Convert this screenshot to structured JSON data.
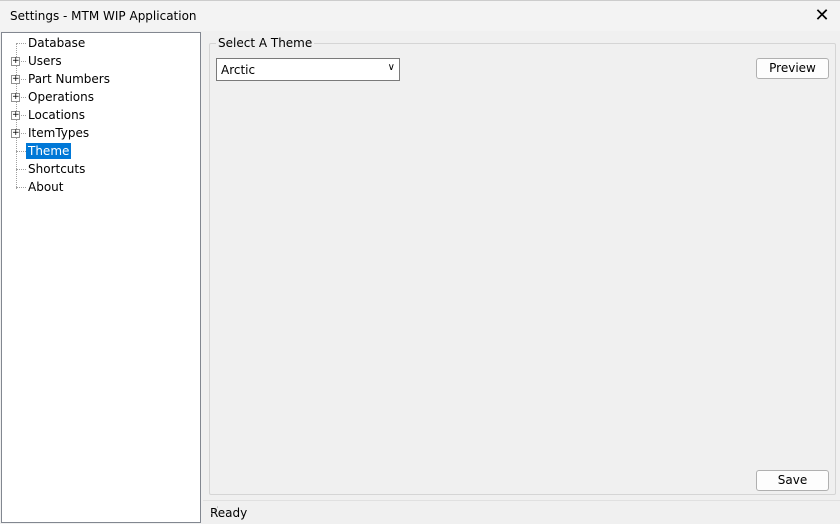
{
  "window": {
    "title": "Settings - MTM WIP Application",
    "close_icon": "close-icon"
  },
  "tree": {
    "items": [
      {
        "label": "Database",
        "expandable": false
      },
      {
        "label": "Users",
        "expandable": true
      },
      {
        "label": "Part Numbers",
        "expandable": true
      },
      {
        "label": "Operations",
        "expandable": true
      },
      {
        "label": "Locations",
        "expandable": true
      },
      {
        "label": "ItemTypes",
        "expandable": true
      },
      {
        "label": "Theme",
        "expandable": false,
        "selected": true
      },
      {
        "label": "Shortcuts",
        "expandable": false
      },
      {
        "label": "About",
        "expandable": false
      }
    ]
  },
  "theme": {
    "group_label": "Select A Theme",
    "selected": "Arctic",
    "preview_label": "Preview",
    "save_label": "Save"
  },
  "status": {
    "text": "Ready"
  },
  "colors": {
    "selection": "#0078d7"
  }
}
